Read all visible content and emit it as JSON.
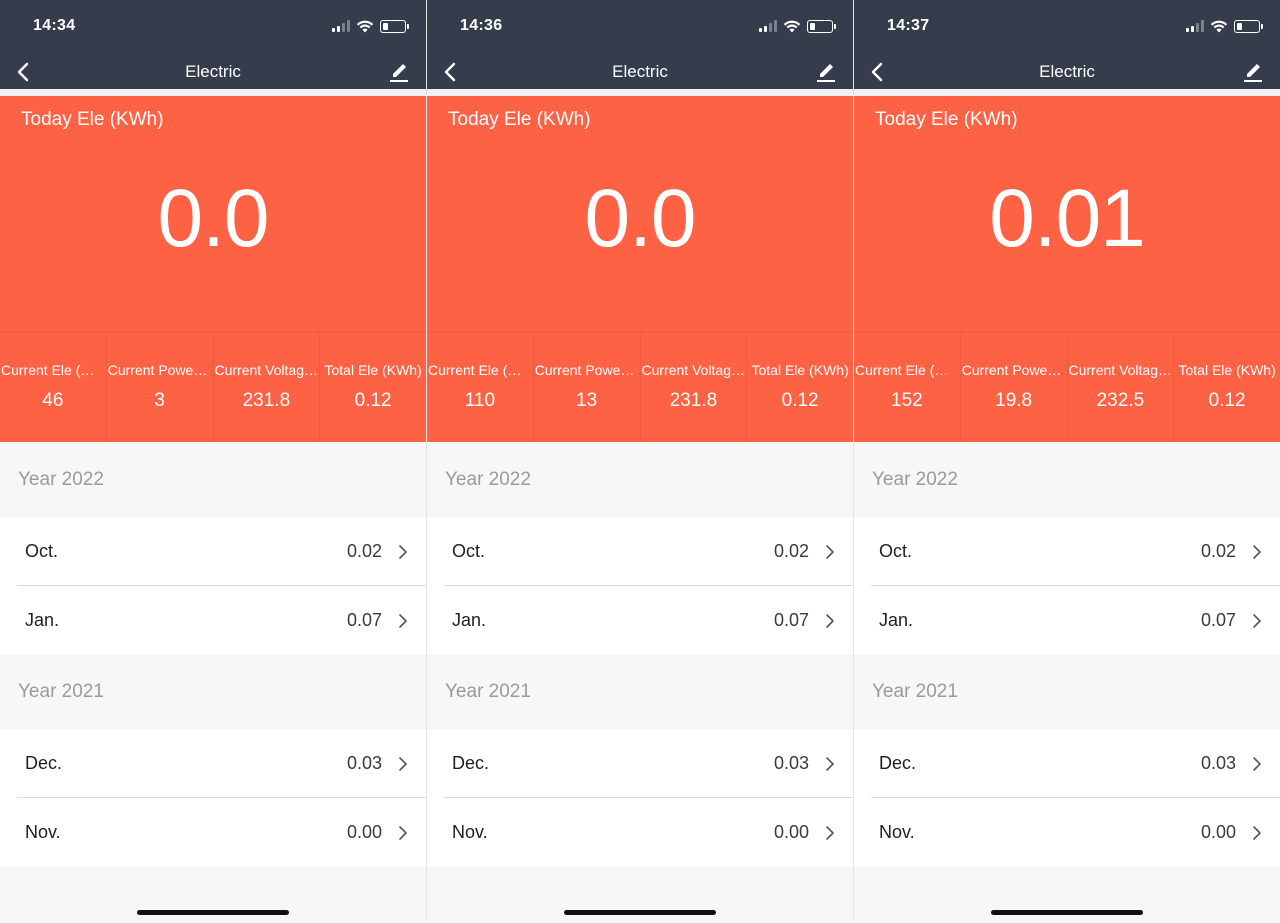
{
  "screens": [
    {
      "time": "14:34",
      "title": "Electric",
      "today_label": "Today Ele (KWh)",
      "today_value": "0.0",
      "metrics": [
        {
          "label": "Current Ele (mA)",
          "value": "46"
        },
        {
          "label": "Current Power (W)",
          "value": "3"
        },
        {
          "label": "Current Voltage (V)",
          "value": "231.8"
        },
        {
          "label": "Total Ele (KWh)",
          "value": "0.12"
        }
      ],
      "years": [
        {
          "label": "Year 2022",
          "months": [
            {
              "name": "Oct.",
              "value": "0.02"
            },
            {
              "name": "Jan.",
              "value": "0.07"
            }
          ]
        },
        {
          "label": "Year 2021",
          "months": [
            {
              "name": "Dec.",
              "value": "0.03"
            },
            {
              "name": "Nov.",
              "value": "0.00"
            }
          ]
        }
      ]
    },
    {
      "time": "14:36",
      "title": "Electric",
      "today_label": "Today Ele (KWh)",
      "today_value": "0.0",
      "metrics": [
        {
          "label": "Current Ele (mA)",
          "value": "110"
        },
        {
          "label": "Current Power (W)",
          "value": "13"
        },
        {
          "label": "Current Voltage (V)",
          "value": "231.8"
        },
        {
          "label": "Total Ele (KWh)",
          "value": "0.12"
        }
      ],
      "years": [
        {
          "label": "Year 2022",
          "months": [
            {
              "name": "Oct.",
              "value": "0.02"
            },
            {
              "name": "Jan.",
              "value": "0.07"
            }
          ]
        },
        {
          "label": "Year 2021",
          "months": [
            {
              "name": "Dec.",
              "value": "0.03"
            },
            {
              "name": "Nov.",
              "value": "0.00"
            }
          ]
        }
      ]
    },
    {
      "time": "14:37",
      "title": "Electric",
      "today_label": "Today Ele (KWh)",
      "today_value": "0.01",
      "metrics": [
        {
          "label": "Current Ele (mA)",
          "value": "152"
        },
        {
          "label": "Current Power (W)",
          "value": "19.8"
        },
        {
          "label": "Current Voltage (V)",
          "value": "232.5"
        },
        {
          "label": "Total Ele (KWh)",
          "value": "0.12"
        }
      ],
      "years": [
        {
          "label": "Year 2022",
          "months": [
            {
              "name": "Oct.",
              "value": "0.02"
            },
            {
              "name": "Jan.",
              "value": "0.07"
            }
          ]
        },
        {
          "label": "Year 2021",
          "months": [
            {
              "name": "Dec.",
              "value": "0.03"
            },
            {
              "name": "Nov.",
              "value": "0.00"
            }
          ]
        }
      ]
    }
  ],
  "icons": {
    "back": "chevron-left-icon",
    "edit": "pencil-icon",
    "row": "chevron-right-icon",
    "signal": "cellular-signal-icon",
    "wifi": "wifi-icon",
    "battery": "battery-low-icon"
  },
  "status": {
    "signal_bars_on": 2,
    "signal_bars_total": 4,
    "battery_level": 0.25
  },
  "colors": {
    "header_bg": "#353c4b",
    "accent": "#fe6245",
    "page_bg": "#f7f7f7"
  }
}
